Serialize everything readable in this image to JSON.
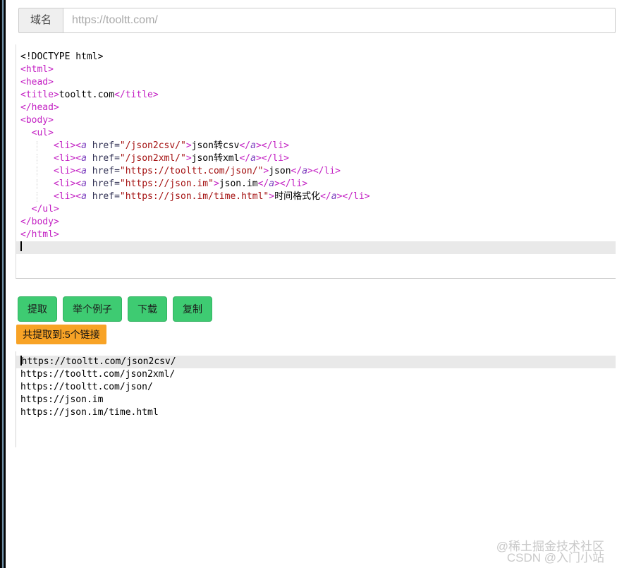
{
  "domain_bar": {
    "label": "域名",
    "input_value": "",
    "input_placeholder": "https://tooltt.com/"
  },
  "code_editor": {
    "lines": [
      {
        "segs": [
          [
            "plain",
            "<!DOCTYPE html>"
          ]
        ]
      },
      {
        "segs": [
          [
            "tag",
            "<html>"
          ]
        ]
      },
      {
        "segs": [
          [
            "tag",
            "<head>"
          ]
        ]
      },
      {
        "segs": [
          [
            "tag",
            "<title>"
          ],
          [
            "plain",
            "tooltt.com"
          ],
          [
            "tag",
            "</title>"
          ]
        ]
      },
      {
        "segs": [
          [
            "tag",
            "</head>"
          ]
        ]
      },
      {
        "segs": [
          [
            "tag",
            "<body>"
          ]
        ]
      },
      {
        "segs": [
          [
            "plain",
            "  "
          ],
          [
            "tag",
            "<ul>"
          ]
        ]
      },
      {
        "guide": true,
        "segs": [
          [
            "plain",
            "      "
          ],
          [
            "tag",
            "<li><"
          ],
          [
            "atag",
            "a"
          ],
          [
            "plain",
            " "
          ],
          [
            "attr",
            "href="
          ],
          [
            "str",
            "\"/json2csv/\""
          ],
          [
            "tag",
            ">"
          ],
          [
            "plain",
            "json转csv"
          ],
          [
            "tag",
            "</"
          ],
          [
            "atag",
            "a"
          ],
          [
            "tag",
            "></li>"
          ]
        ]
      },
      {
        "guide": true,
        "segs": [
          [
            "plain",
            "      "
          ],
          [
            "tag",
            "<li><"
          ],
          [
            "atag",
            "a"
          ],
          [
            "plain",
            " "
          ],
          [
            "attr",
            "href="
          ],
          [
            "str",
            "\"/json2xml/\""
          ],
          [
            "tag",
            ">"
          ],
          [
            "plain",
            "json转xml"
          ],
          [
            "tag",
            "</"
          ],
          [
            "atag",
            "a"
          ],
          [
            "tag",
            "></li>"
          ]
        ]
      },
      {
        "guide": true,
        "segs": [
          [
            "plain",
            "      "
          ],
          [
            "tag",
            "<li><"
          ],
          [
            "atag",
            "a"
          ],
          [
            "plain",
            " "
          ],
          [
            "attr",
            "href="
          ],
          [
            "str",
            "\"https://tooltt.com/json/\""
          ],
          [
            "tag",
            ">"
          ],
          [
            "plain",
            "json"
          ],
          [
            "tag",
            "</"
          ],
          [
            "atag",
            "a"
          ],
          [
            "tag",
            "></li>"
          ]
        ]
      },
      {
        "guide": true,
        "segs": [
          [
            "plain",
            "      "
          ],
          [
            "tag",
            "<li><"
          ],
          [
            "atag",
            "a"
          ],
          [
            "plain",
            " "
          ],
          [
            "attr",
            "href="
          ],
          [
            "str",
            "\"https://json.im\""
          ],
          [
            "tag",
            ">"
          ],
          [
            "plain",
            "json.im"
          ],
          [
            "tag",
            "</"
          ],
          [
            "atag",
            "a"
          ],
          [
            "tag",
            "></li>"
          ]
        ]
      },
      {
        "guide": true,
        "segs": [
          [
            "plain",
            "      "
          ],
          [
            "tag",
            "<li><"
          ],
          [
            "atag",
            "a"
          ],
          [
            "plain",
            " "
          ],
          [
            "attr",
            "href="
          ],
          [
            "str",
            "\"https://json.im/time.html\""
          ],
          [
            "tag",
            ">"
          ],
          [
            "plain",
            "时间格式化"
          ],
          [
            "tag",
            "</"
          ],
          [
            "atag",
            "a"
          ],
          [
            "tag",
            "></li>"
          ]
        ]
      },
      {
        "segs": [
          [
            "plain",
            "  "
          ],
          [
            "tag",
            "</ul>"
          ]
        ]
      },
      {
        "segs": [
          [
            "tag",
            "</body>"
          ]
        ]
      },
      {
        "segs": [
          [
            "tag",
            "</html>"
          ]
        ]
      },
      {
        "active": true,
        "cursor": true,
        "segs": []
      }
    ]
  },
  "toolbar": {
    "buttons": [
      {
        "name": "extract",
        "label": "提取"
      },
      {
        "name": "example",
        "label": "举个例子"
      },
      {
        "name": "download",
        "label": "下载"
      },
      {
        "name": "copy",
        "label": "复制"
      }
    ]
  },
  "status_badge": {
    "text": "共提取到:5个链接"
  },
  "results": {
    "active_line": 0,
    "lines": [
      "https://tooltt.com/json2csv/",
      "https://tooltt.com/json2xml/",
      "https://tooltt.com/json/",
      "https://json.im",
      "https://json.im/time.html"
    ]
  },
  "watermark": {
    "line1": "@稀土掘金技术社区",
    "line2": "CSDN @入门小站"
  },
  "colors": {
    "button_bg": "#3ecb72",
    "badge_bg": "#f8a326",
    "tag": "#c31fc3",
    "a_tag": "#7a3dbd",
    "attribute": "#333355",
    "string": "#a41111",
    "active_line_bg": "#e9e9e9"
  }
}
